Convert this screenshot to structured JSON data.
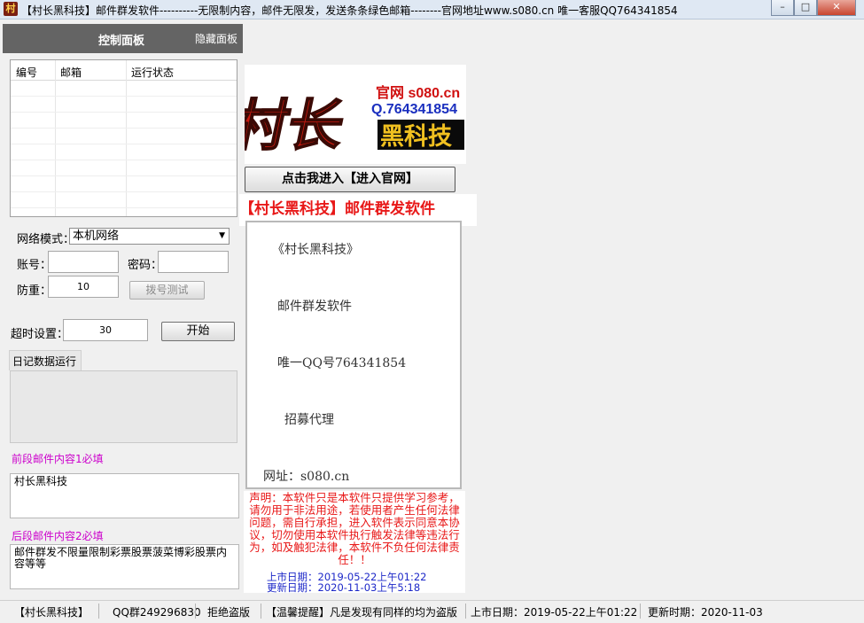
{
  "window": {
    "title": "【村长黑科技】邮件群发软件----------无限制内容，邮件无限发，发送条条绿色邮箱--------官网地址www.s080.cn   唯一客服QQ764341854",
    "icon_text": "村"
  },
  "left_panel": {
    "title": "控制面板",
    "hide_label": "隐藏面板",
    "list_headers": [
      "编号",
      "邮箱",
      "运行状态"
    ],
    "network_mode_label": "网络模式：",
    "network_mode_value": "本机网络",
    "account_label": "账号：",
    "account_value": "",
    "password_label": "密码：",
    "password_value": "",
    "weight_label": "防重：",
    "weight_value": "10",
    "dial_test_label": "拨号测试",
    "timeout_label": "超时设置：",
    "timeout_value": "30",
    "start_label": "开始",
    "log_tab_label": "日记数据运行",
    "front_content_label": "前段邮件内容1必填",
    "front_content_value": "村长黑科技",
    "back_content_label": "后段邮件内容2必填",
    "back_content_value": "邮件群发不限量限制彩票股票菠菜博彩股票内容等等"
  },
  "logo": {
    "brand": "村长",
    "site": "官网 s080.cn",
    "qq": "Q.764341854",
    "tag": "黑科技"
  },
  "enter_site_label": "点击我进入【进入官网】",
  "software_title": "【村长黑科技】邮件群发软件",
  "info_lines": {
    "line1": "《村长黑科技》",
    "line2": "邮件群发软件",
    "line3": "唯一QQ号764341854",
    "line4": "招募代理",
    "line5": "网址：s080.cn"
  },
  "notice": "声明：本软件只是本软件只提供学习参考，请勿用于非法用途，若使用者产生任何法律问题，需自行承担，进入软件表示同意本协议，切勿使用本软件执行触发法律等违法行为，如及触犯法律，本软件不负任何法律责任！！",
  "release_date": "上市日期：2019-05-22上午01:22",
  "update_date": "更新日期：2020-11-03上午5:18",
  "status_bar": {
    "brand": "【村长黑科技】",
    "qq_group": "QQ群249296830",
    "anti_piracy": "拒绝盗版",
    "tip": "【温馨提醒】凡是发现有同样的均为盗版",
    "release": "上市日期：2019-05-22上午01:22",
    "update": "更新时期：2020-11-03"
  },
  "colors": {
    "panel_header": "#646464",
    "accent_red": "#e81818",
    "pink_label": "#cc00cc",
    "date_blue": "#1d28c8"
  }
}
